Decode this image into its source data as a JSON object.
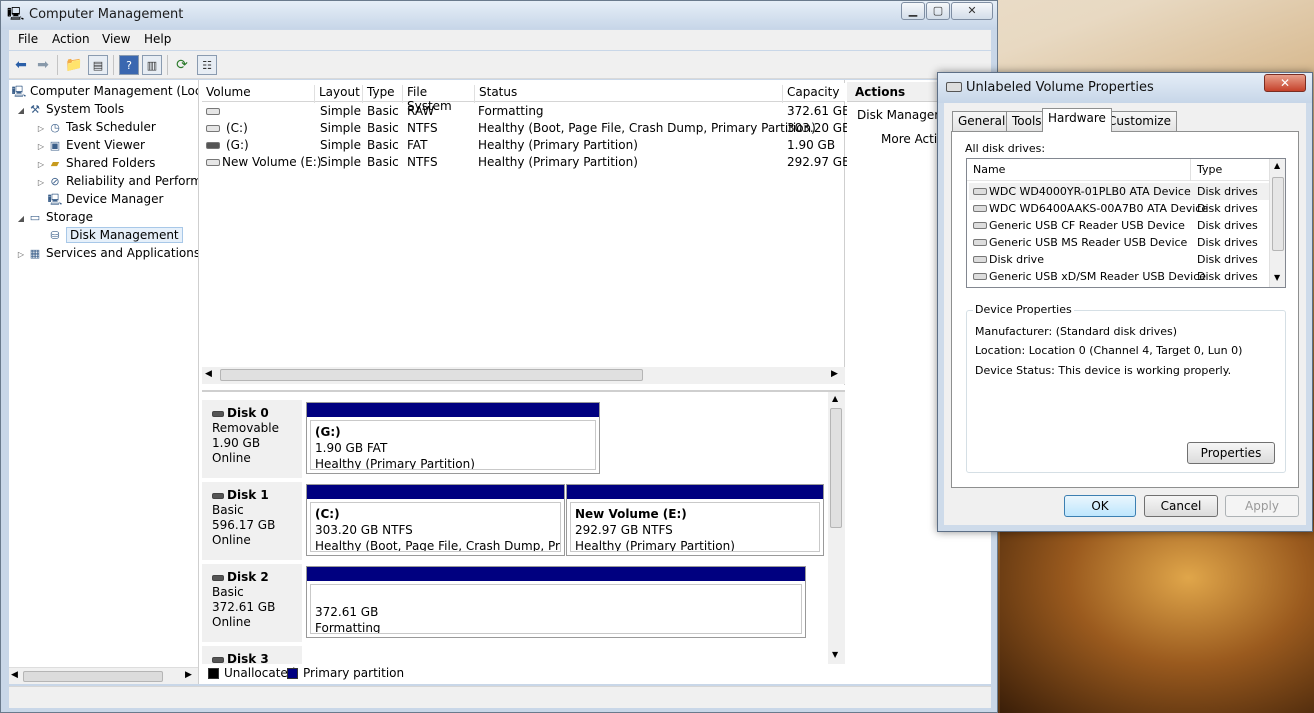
{
  "window": {
    "title": "Computer Management",
    "min_label": "▁",
    "max_label": "▢",
    "close_label": "✕"
  },
  "menu": [
    "File",
    "Action",
    "View",
    "Help"
  ],
  "tree": {
    "root": "Computer Management (Local",
    "system_tools": "System Tools",
    "task_scheduler": "Task Scheduler",
    "event_viewer": "Event Viewer",
    "shared_folders": "Shared Folders",
    "reliability": "Reliability and Performa",
    "device_manager": "Device Manager",
    "storage": "Storage",
    "disk_management": "Disk Management",
    "services": "Services and Applications"
  },
  "volumes": {
    "headers": [
      "Volume",
      "Layout",
      "Type",
      "File System",
      "Status",
      "Capacity"
    ],
    "rows": [
      {
        "volume": "",
        "layout": "Simple",
        "type": "Basic",
        "fs": "RAW",
        "status": "Formatting",
        "capacity": "372.61 GB"
      },
      {
        "volume": "(C:)",
        "layout": "Simple",
        "type": "Basic",
        "fs": "NTFS",
        "status": "Healthy (Boot, Page File, Crash Dump, Primary Partition)",
        "capacity": "303.20 GB"
      },
      {
        "volume": "(G:)",
        "layout": "Simple",
        "type": "Basic",
        "fs": "FAT",
        "status": "Healthy (Primary Partition)",
        "capacity": "1.90 GB"
      },
      {
        "volume": "New Volume (E:)",
        "layout": "Simple",
        "type": "Basic",
        "fs": "NTFS",
        "status": "Healthy (Primary Partition)",
        "capacity": "292.97 GB"
      }
    ]
  },
  "disks": {
    "d0": {
      "name": "Disk 0",
      "kind": "Removable",
      "size": "1.90 GB",
      "state": "Online",
      "p1": {
        "title": "(G:)",
        "line1": "1.90 GB FAT",
        "line2": "Healthy (Primary Partition)"
      }
    },
    "d1": {
      "name": "Disk 1",
      "kind": "Basic",
      "size": "596.17 GB",
      "state": "Online",
      "p1": {
        "title": "(C:)",
        "line1": "303.20 GB NTFS",
        "line2": "Healthy (Boot, Page File, Crash Dump, Primary"
      },
      "p2": {
        "title": "New Volume  (E:)",
        "line1": "292.97 GB NTFS",
        "line2": "Healthy (Primary Partition)"
      }
    },
    "d2": {
      "name": "Disk 2",
      "kind": "Basic",
      "size": "372.61 GB",
      "state": "Online",
      "p1": {
        "title": "",
        "line1": "372.61 GB",
        "line2": "Formatting"
      }
    },
    "d3": {
      "name": "Disk 3"
    }
  },
  "legend": {
    "unallocated": "Unallocated",
    "primary": "Primary partition",
    "unallocated_color": "#000000",
    "primary_color": "#000080"
  },
  "actions": {
    "title": "Actions",
    "item1": "Disk Managem",
    "item2": "More Actio"
  },
  "dialog": {
    "title": "Unlabeled Volume Properties",
    "close_label": "✕",
    "tabs": [
      "General",
      "Tools",
      "Hardware",
      "Customize"
    ],
    "all_drives_label": "All disk drives:",
    "col_name": "Name",
    "col_type": "Type",
    "drives": [
      {
        "name": "WDC WD4000YR-01PLB0 ATA Device",
        "type": "Disk drives"
      },
      {
        "name": "WDC WD6400AAKS-00A7B0 ATA Device",
        "type": "Disk drives"
      },
      {
        "name": "Generic USB CF Reader USB Device",
        "type": "Disk drives"
      },
      {
        "name": "Generic USB MS Reader USB Device",
        "type": "Disk drives"
      },
      {
        "name": "Disk drive",
        "type": "Disk drives"
      },
      {
        "name": "Generic USB xD/SM Reader USB Device",
        "type": "Disk drives"
      }
    ],
    "device_properties": "Device Properties",
    "manufacturer": "Manufacturer: (Standard disk drives)",
    "location": "Location: Location 0 (Channel 4, Target 0, Lun 0)",
    "device_status": "Device Status: This device is working properly.",
    "properties_button": "Properties",
    "ok": "OK",
    "cancel": "Cancel",
    "apply": "Apply"
  }
}
